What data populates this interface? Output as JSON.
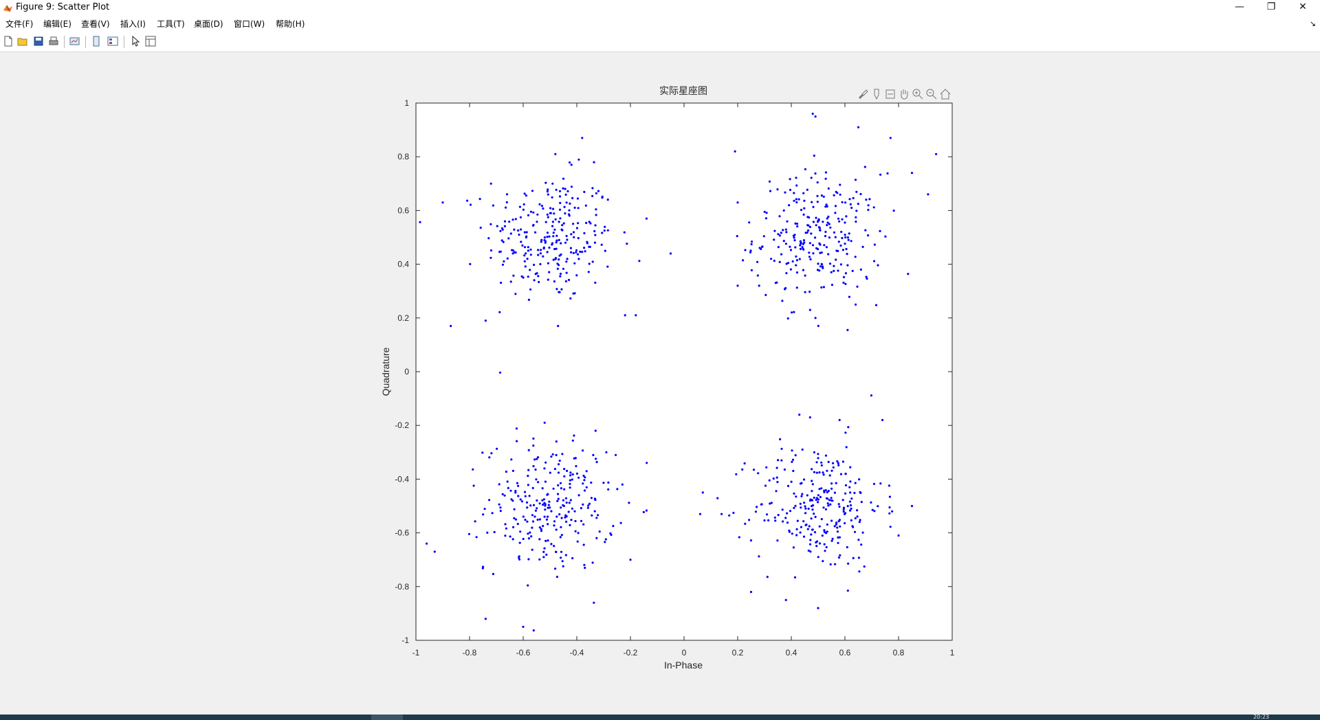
{
  "window": {
    "title": "Figure 9: Scatter Plot",
    "minimize": "—",
    "restore": "❐",
    "close": "✕"
  },
  "menu": {
    "items": [
      "文件(F)",
      "编辑(E)",
      "查看(V)",
      "插入(I)",
      "工具(T)",
      "桌面(D)",
      "窗口(W)",
      "帮助(H)"
    ],
    "dock_glyph": "↘"
  },
  "toolbar": {
    "icons": [
      "new-figure-icon",
      "open-file-icon",
      "save-icon",
      "print-icon",
      "link-plot-icon",
      "hide-plot-tools-icon",
      "show-plot-tools-icon",
      "edit-plot-arrow-icon",
      "property-inspector-icon"
    ]
  },
  "axes_toolbar": {
    "icons": [
      "brush-icon",
      "data-tip-icon",
      "restore-view-icon",
      "pan-hand-icon",
      "zoom-in-icon",
      "zoom-out-icon",
      "home-icon"
    ]
  },
  "taskbar": {
    "clock": "20:23"
  },
  "colors": {
    "marker": "#0000ff",
    "axes_bg": "#ffffff",
    "figure_bg": "#f0f0f0"
  },
  "chart_data": {
    "type": "scatter",
    "title": "实际星座图",
    "xlabel": "In-Phase",
    "ylabel": "Quadrature",
    "xlim": [
      -1,
      1
    ],
    "ylim": [
      -1,
      1
    ],
    "xticks": [
      -1,
      -0.8,
      -0.6,
      -0.4,
      -0.2,
      0,
      0.2,
      0.4,
      0.6,
      0.8,
      1
    ],
    "yticks": [
      -1,
      -0.8,
      -0.6,
      -0.4,
      -0.2,
      0,
      0.2,
      0.4,
      0.6,
      0.8,
      1
    ],
    "xtick_labels": [
      "-1",
      "-0.8",
      "-0.6",
      "-0.4",
      "-0.2",
      "0",
      "0.2",
      "0.4",
      "0.6",
      "0.8",
      "1"
    ],
    "ytick_labels": [
      "-1",
      "-0.8",
      "-0.6",
      "-0.4",
      "-0.2",
      "0",
      "0.2",
      "0.4",
      "0.6",
      "0.8",
      "1"
    ],
    "grid": false,
    "box": true,
    "marker": "point",
    "points_per_cluster": 260,
    "cluster_centers": [
      [
        -0.5,
        0.5
      ],
      [
        0.5,
        0.5
      ],
      [
        -0.5,
        -0.5
      ],
      [
        0.5,
        -0.5
      ]
    ],
    "spread_std": 0.12,
    "points": [
      [
        -0.9,
        0.63
      ],
      [
        -0.87,
        0.17
      ],
      [
        -0.74,
        0.19
      ],
      [
        -0.38,
        0.87
      ],
      [
        -0.18,
        0.21
      ],
      [
        -0.22,
        0.21
      ],
      [
        -0.05,
        0.44
      ],
      [
        -0.14,
        0.57
      ],
      [
        -0.48,
        0.81
      ],
      [
        -0.42,
        0.77
      ],
      [
        -0.47,
        0.17
      ],
      [
        -0.72,
        0.7
      ],
      [
        0.19,
        0.82
      ],
      [
        0.2,
        0.63
      ],
      [
        0.48,
        0.96
      ],
      [
        0.49,
        0.95
      ],
      [
        0.65,
        0.91
      ],
      [
        0.77,
        0.87
      ],
      [
        0.94,
        0.81
      ],
      [
        0.91,
        0.66
      ],
      [
        0.85,
        0.74
      ],
      [
        0.2,
        0.32
      ],
      [
        0.28,
        0.32
      ],
      [
        0.49,
        0.2
      ],
      [
        0.47,
        0.23
      ],
      [
        0.64,
        0.25
      ],
      [
        -0.96,
        -0.64
      ],
      [
        -0.93,
        -0.67
      ],
      [
        -0.74,
        -0.92
      ],
      [
        -0.6,
        -0.95
      ],
      [
        -0.52,
        -0.19
      ],
      [
        -0.33,
        -0.22
      ],
      [
        -0.29,
        -0.3
      ],
      [
        -0.23,
        -0.42
      ],
      [
        -0.2,
        -0.7
      ],
      [
        0.06,
        -0.53
      ],
      [
        0.07,
        -0.45
      ],
      [
        0.14,
        -0.53
      ],
      [
        0.47,
        -0.17
      ],
      [
        0.43,
        -0.16
      ],
      [
        0.58,
        -0.18
      ],
      [
        0.74,
        -0.18
      ],
      [
        0.85,
        -0.5
      ],
      [
        0.8,
        -0.61
      ],
      [
        0.5,
        -0.88
      ],
      [
        0.38,
        -0.85
      ],
      [
        0.25,
        -0.82
      ]
    ]
  }
}
